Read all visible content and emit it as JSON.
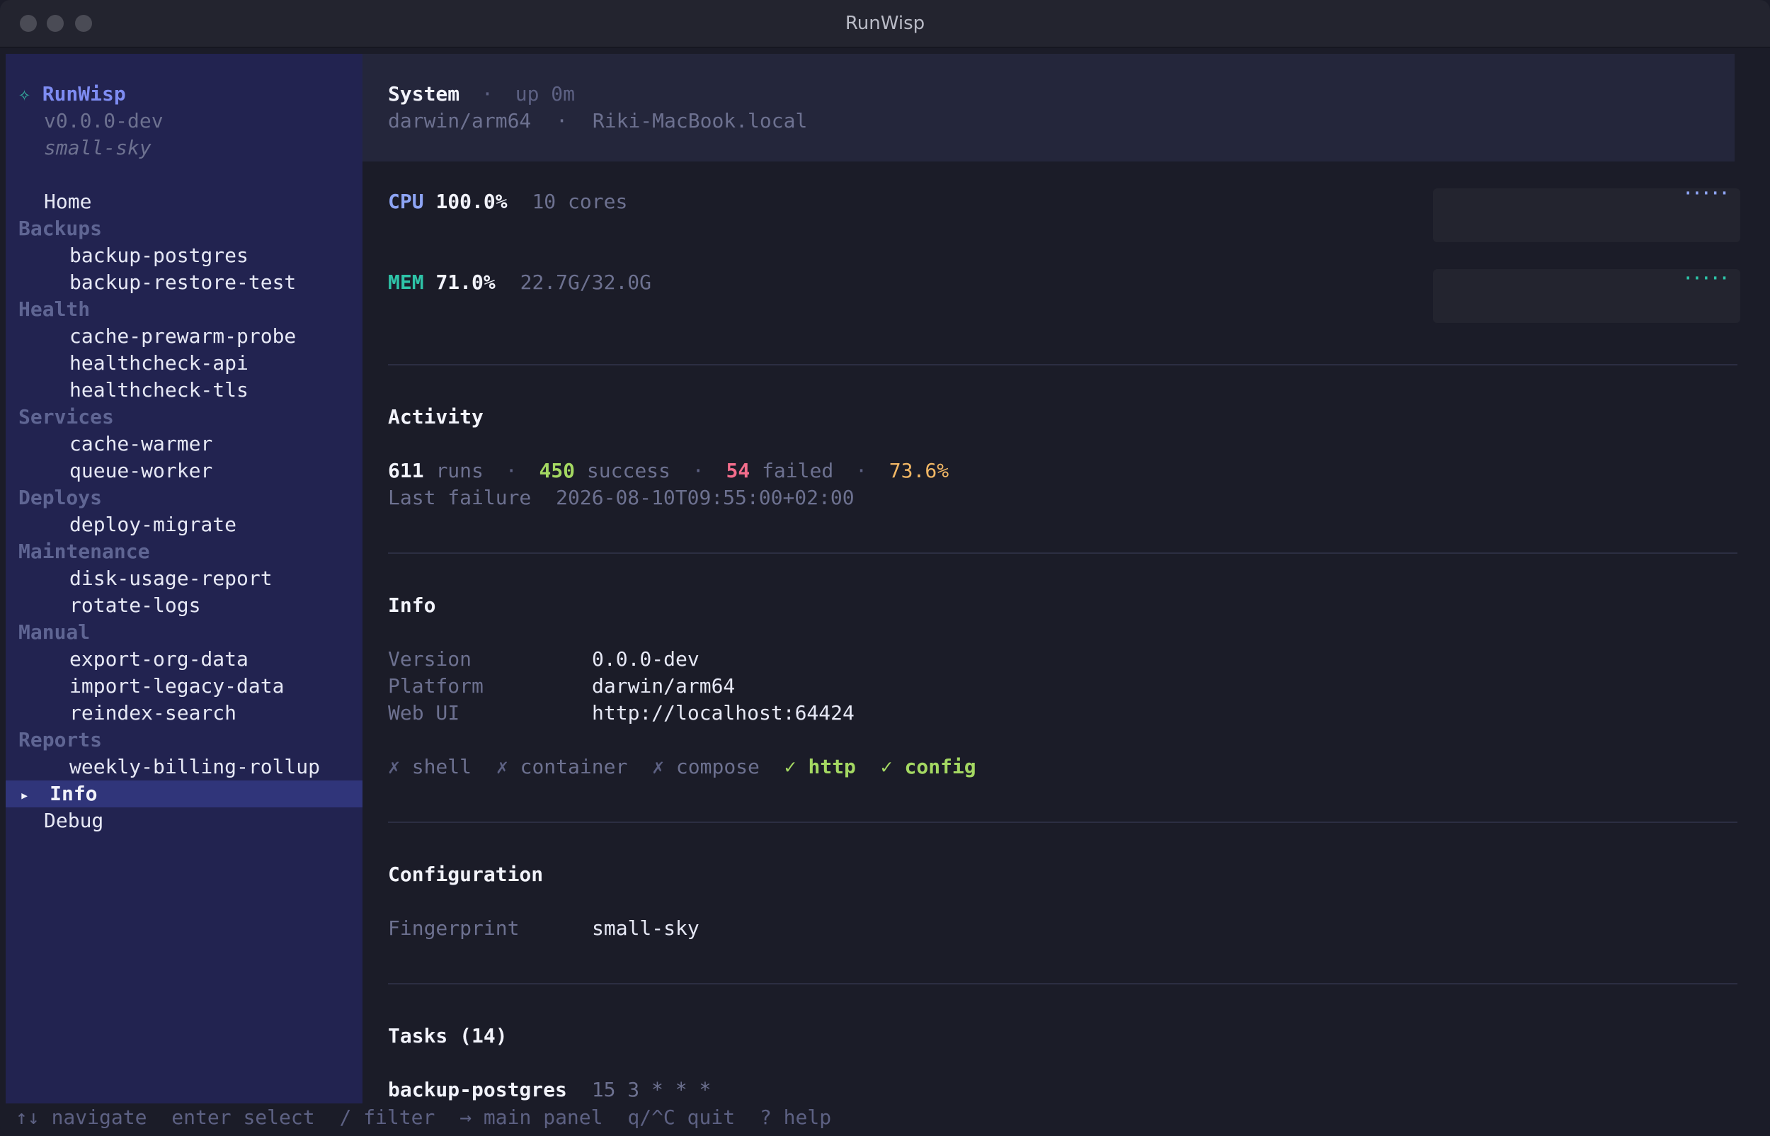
{
  "window": {
    "title": "RunWisp"
  },
  "sidebar": {
    "app_mark": "✧",
    "app_name": "RunWisp",
    "version": "v0.0.0-dev",
    "fingerprint": "small-sky",
    "home": "Home",
    "groups": [
      {
        "label": "Backups",
        "items": [
          "backup-postgres",
          "backup-restore-test"
        ]
      },
      {
        "label": "Health",
        "items": [
          "cache-prewarm-probe",
          "healthcheck-api",
          "healthcheck-tls"
        ]
      },
      {
        "label": "Services",
        "items": [
          "cache-warmer",
          "queue-worker"
        ]
      },
      {
        "label": "Deploys",
        "items": [
          "deploy-migrate"
        ]
      },
      {
        "label": "Maintenance",
        "items": [
          "disk-usage-report",
          "rotate-logs"
        ]
      },
      {
        "label": "Manual",
        "items": [
          "export-org-data",
          "import-legacy-data",
          "reindex-search"
        ]
      },
      {
        "label": "Reports",
        "items": [
          "weekly-billing-rollup"
        ]
      }
    ],
    "selected_marker": "▸",
    "info": "Info",
    "debug": "Debug"
  },
  "system": {
    "title": "System",
    "sep": "·",
    "uptime": "up 0m",
    "platform": "darwin/arm64",
    "host": "Riki-MacBook.local"
  },
  "cpu": {
    "label": "CPU",
    "value": "100.0%",
    "detail": "10 cores",
    "spark": "·····"
  },
  "mem": {
    "label": "MEM",
    "value": "71.0%",
    "detail": "22.7G/32.0G",
    "spark": "·····"
  },
  "activity": {
    "title": "Activity",
    "runs": "611",
    "runs_label": "runs",
    "success": "450",
    "success_label": "success",
    "failed": "54",
    "failed_label": "failed",
    "rate": "73.6%",
    "last_failure_label": "Last failure",
    "last_failure": "2026-08-10T09:55:00+02:00"
  },
  "info": {
    "title": "Info",
    "rows": [
      {
        "key": "Version",
        "value": "0.0.0-dev"
      },
      {
        "key": "Platform",
        "value": "darwin/arm64"
      },
      {
        "key": "Web UI",
        "value": "http://localhost:64424"
      }
    ],
    "capabilities": [
      {
        "mark": "✗",
        "label": "shell",
        "enabled": false
      },
      {
        "mark": "✗",
        "label": "container",
        "enabled": false
      },
      {
        "mark": "✗",
        "label": "compose",
        "enabled": false
      },
      {
        "mark": "✓",
        "label": "http",
        "enabled": true
      },
      {
        "mark": "✓",
        "label": "config",
        "enabled": true
      }
    ]
  },
  "configuration": {
    "title": "Configuration",
    "key": "Fingerprint",
    "value": "small-sky"
  },
  "tasks": {
    "title": "Tasks (14)",
    "first_name": "backup-postgres",
    "first_schedule": "15 3 * * *"
  },
  "statusbar": {
    "navigate_key": "↑↓",
    "navigate": "navigate",
    "select_key": "enter",
    "select": "select",
    "filter_key": "/",
    "filter": "filter",
    "main_key": "→",
    "main": "main panel",
    "quit_key": "q/^C",
    "quit": "quit",
    "help_key": "?",
    "help": "help"
  },
  "colors": {
    "sidebar_bg": "#222350",
    "main_bg": "#1b1c28",
    "accent": "#7e8cf2",
    "success": "#a4d862",
    "failed": "#f36d8c",
    "rate": "#f2b765",
    "mem": "#2ec4a8"
  }
}
